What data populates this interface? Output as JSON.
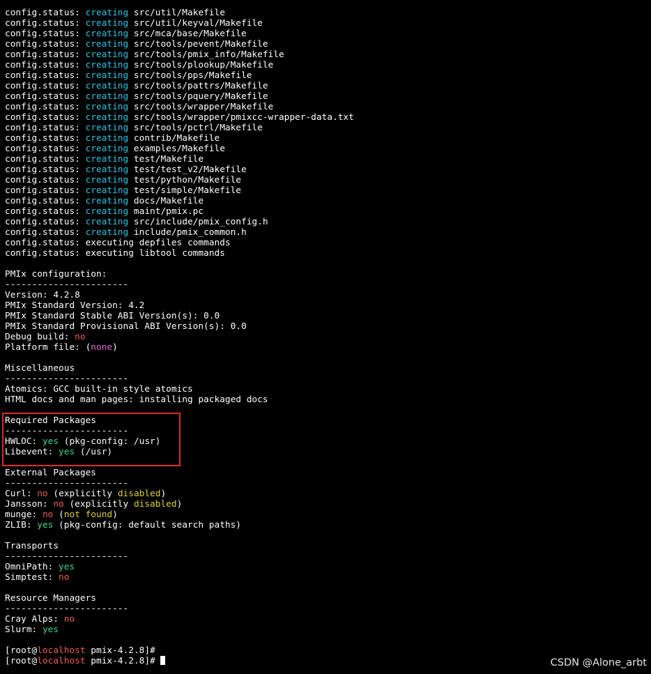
{
  "colors": {
    "background": "#000000",
    "text": "#ffffff",
    "cyan": "#2ec5e8",
    "green": "#3fd68f",
    "red": "#f05a5a",
    "magenta": "#e06ad6",
    "yellow": "#ddd02e",
    "highlight_box": "#e02a2a"
  },
  "terminal_lines": [
    [
      {
        "t": "config.status: "
      },
      {
        "t": "creating",
        "c": "cyan"
      },
      {
        "t": " src/util/Makefile"
      }
    ],
    [
      {
        "t": "config.status: "
      },
      {
        "t": "creating",
        "c": "cyan"
      },
      {
        "t": " src/util/keyval/Makefile"
      }
    ],
    [
      {
        "t": "config.status: "
      },
      {
        "t": "creating",
        "c": "cyan"
      },
      {
        "t": " src/mca/base/Makefile"
      }
    ],
    [
      {
        "t": "config.status: "
      },
      {
        "t": "creating",
        "c": "cyan"
      },
      {
        "t": " src/tools/pevent/Makefile"
      }
    ],
    [
      {
        "t": "config.status: "
      },
      {
        "t": "creating",
        "c": "cyan"
      },
      {
        "t": " src/tools/pmix_info/Makefile"
      }
    ],
    [
      {
        "t": "config.status: "
      },
      {
        "t": "creating",
        "c": "cyan"
      },
      {
        "t": " src/tools/plookup/Makefile"
      }
    ],
    [
      {
        "t": "config.status: "
      },
      {
        "t": "creating",
        "c": "cyan"
      },
      {
        "t": " src/tools/pps/Makefile"
      }
    ],
    [
      {
        "t": "config.status: "
      },
      {
        "t": "creating",
        "c": "cyan"
      },
      {
        "t": " src/tools/pattrs/Makefile"
      }
    ],
    [
      {
        "t": "config.status: "
      },
      {
        "t": "creating",
        "c": "cyan"
      },
      {
        "t": " src/tools/pquery/Makefile"
      }
    ],
    [
      {
        "t": "config.status: "
      },
      {
        "t": "creating",
        "c": "cyan"
      },
      {
        "t": " src/tools/wrapper/Makefile"
      }
    ],
    [
      {
        "t": "config.status: "
      },
      {
        "t": "creating",
        "c": "cyan"
      },
      {
        "t": " src/tools/wrapper/pmixcc-wrapper-data.txt"
      }
    ],
    [
      {
        "t": "config.status: "
      },
      {
        "t": "creating",
        "c": "cyan"
      },
      {
        "t": " src/tools/pctrl/Makefile"
      }
    ],
    [
      {
        "t": "config.status: "
      },
      {
        "t": "creating",
        "c": "cyan"
      },
      {
        "t": " contrib/Makefile"
      }
    ],
    [
      {
        "t": "config.status: "
      },
      {
        "t": "creating",
        "c": "cyan"
      },
      {
        "t": " examples/Makefile"
      }
    ],
    [
      {
        "t": "config.status: "
      },
      {
        "t": "creating",
        "c": "cyan"
      },
      {
        "t": " test/Makefile"
      }
    ],
    [
      {
        "t": "config.status: "
      },
      {
        "t": "creating",
        "c": "cyan"
      },
      {
        "t": " test/test_v2/Makefile"
      }
    ],
    [
      {
        "t": "config.status: "
      },
      {
        "t": "creating",
        "c": "cyan"
      },
      {
        "t": " test/python/Makefile"
      }
    ],
    [
      {
        "t": "config.status: "
      },
      {
        "t": "creating",
        "c": "cyan"
      },
      {
        "t": " test/simple/Makefile"
      }
    ],
    [
      {
        "t": "config.status: "
      },
      {
        "t": "creating",
        "c": "cyan"
      },
      {
        "t": " docs/Makefile"
      }
    ],
    [
      {
        "t": "config.status: "
      },
      {
        "t": "creating",
        "c": "cyan"
      },
      {
        "t": " maint/pmix.pc"
      }
    ],
    [
      {
        "t": "config.status: "
      },
      {
        "t": "creating",
        "c": "cyan"
      },
      {
        "t": " src/include/pmix_config.h"
      }
    ],
    [
      {
        "t": "config.status: "
      },
      {
        "t": "creating",
        "c": "cyan"
      },
      {
        "t": " include/pmix_common.h"
      }
    ],
    [
      {
        "t": "config.status: executing depfiles commands"
      }
    ],
    [
      {
        "t": "config.status: executing libtool commands"
      }
    ],
    [
      {
        "t": ""
      }
    ],
    [
      {
        "t": "PMIx configuration:"
      }
    ],
    [
      {
        "t": "-----------------------"
      }
    ],
    [
      {
        "t": "Version: 4.2.8"
      }
    ],
    [
      {
        "t": "PMIx Standard Version: 4.2"
      }
    ],
    [
      {
        "t": "PMIx Standard Stable ABI Version(s): 0.0"
      }
    ],
    [
      {
        "t": "PMIx Standard Provisional ABI Version(s): 0.0"
      }
    ],
    [
      {
        "t": "Debug build: "
      },
      {
        "t": "no",
        "c": "red"
      }
    ],
    [
      {
        "t": "Platform file: ("
      },
      {
        "t": "none",
        "c": "magenta"
      },
      {
        "t": ")"
      }
    ],
    [
      {
        "t": ""
      }
    ],
    [
      {
        "t": "Miscellaneous"
      }
    ],
    [
      {
        "t": "-----------------------"
      }
    ],
    [
      {
        "t": "Atomics: GCC built-in style atomics"
      }
    ],
    [
      {
        "t": "HTML docs and man pages: installing packaged docs"
      }
    ],
    [
      {
        "t": ""
      }
    ],
    [
      {
        "t": "Required Packages"
      }
    ],
    [
      {
        "t": "-----------------------"
      }
    ],
    [
      {
        "t": "HWLOC: "
      },
      {
        "t": "yes",
        "c": "green"
      },
      {
        "t": " (pkg-config: /usr)"
      }
    ],
    [
      {
        "t": "Libevent: "
      },
      {
        "t": "yes",
        "c": "green"
      },
      {
        "t": " (/usr)"
      }
    ],
    [
      {
        "t": ""
      }
    ],
    [
      {
        "t": "External Packages"
      }
    ],
    [
      {
        "t": "-----------------------"
      }
    ],
    [
      {
        "t": "Curl: "
      },
      {
        "t": "no",
        "c": "red"
      },
      {
        "t": " (explicitly "
      },
      {
        "t": "disabled",
        "c": "yellow"
      },
      {
        "t": ")"
      }
    ],
    [
      {
        "t": "Jansson: "
      },
      {
        "t": "no",
        "c": "red"
      },
      {
        "t": " (explicitly "
      },
      {
        "t": "disabled",
        "c": "yellow"
      },
      {
        "t": ")"
      }
    ],
    [
      {
        "t": "munge: "
      },
      {
        "t": "no",
        "c": "red"
      },
      {
        "t": " ("
      },
      {
        "t": "not found",
        "c": "yellow"
      },
      {
        "t": ")"
      }
    ],
    [
      {
        "t": "ZLIB: "
      },
      {
        "t": "yes",
        "c": "green"
      },
      {
        "t": " (pkg-config: default search paths)"
      }
    ],
    [
      {
        "t": ""
      }
    ],
    [
      {
        "t": "Transports"
      }
    ],
    [
      {
        "t": "-----------------------"
      }
    ],
    [
      {
        "t": "OmniPath: "
      },
      {
        "t": "yes",
        "c": "green"
      }
    ],
    [
      {
        "t": "Simptest: "
      },
      {
        "t": "no",
        "c": "red"
      }
    ],
    [
      {
        "t": ""
      }
    ],
    [
      {
        "t": "Resource Managers"
      }
    ],
    [
      {
        "t": "-----------------------"
      }
    ],
    [
      {
        "t": "Cray Alps: "
      },
      {
        "t": "no",
        "c": "red"
      }
    ],
    [
      {
        "t": "Slurm: "
      },
      {
        "t": "yes",
        "c": "green"
      }
    ],
    [
      {
        "t": ""
      }
    ],
    [
      {
        "t": "[root@"
      },
      {
        "t": "localhost",
        "c": "red"
      },
      {
        "t": " pmix-4.2.8]#"
      }
    ],
    [
      {
        "t": "[root@"
      },
      {
        "t": "localhost",
        "c": "red"
      },
      {
        "t": " pmix-4.2.8]# "
      },
      {
        "cursor": true
      }
    ]
  ],
  "watermark": "CSDN @Alone_arbt"
}
